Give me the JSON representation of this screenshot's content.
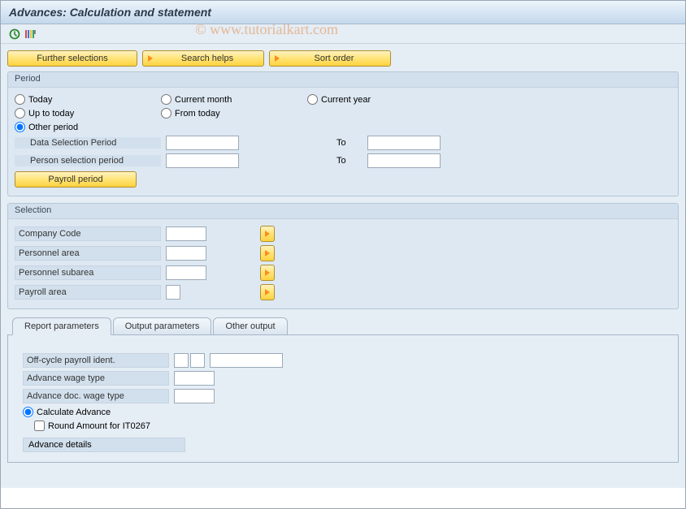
{
  "title": "Advances: Calculation and statement",
  "watermark": "© www.tutorialkart.com",
  "toolbar_buttons": {
    "further_selections": "Further selections",
    "search_helps": "Search helps",
    "sort_order": "Sort order"
  },
  "period": {
    "group_title": "Period",
    "today": "Today",
    "current_month": "Current month",
    "current_year": "Current year",
    "up_to_today": "Up to today",
    "from_today": "From today",
    "other_period": "Other period",
    "data_selection_period": "Data Selection Period",
    "person_selection_period": "Person selection period",
    "to": "To",
    "payroll_period_btn": "Payroll period",
    "data_sel_from": "",
    "data_sel_to": "",
    "person_sel_from": "",
    "person_sel_to": ""
  },
  "selection": {
    "group_title": "Selection",
    "company_code": "Company Code",
    "personnel_area": "Personnel area",
    "personnel_subarea": "Personnel subarea",
    "payroll_area": "Payroll area",
    "company_code_val": "",
    "personnel_area_val": "",
    "personnel_subarea_val": "",
    "payroll_area_val": ""
  },
  "tabs": {
    "report_params": "Report parameters",
    "output_params": "Output parameters",
    "other_output": "Other output"
  },
  "report": {
    "offcycle_ident": "Off-cycle payroll ident.",
    "advance_wage_type": "Advance wage type",
    "advance_doc_wage_type": "Advance doc. wage type",
    "calculate_advance": "Calculate Advance",
    "round_amount": "Round Amount for IT0267",
    "advance_details": "Advance details",
    "offcycle_v1": "",
    "offcycle_v2": "",
    "offcycle_v3": "",
    "adv_wage_val": "",
    "adv_doc_wage_val": ""
  }
}
